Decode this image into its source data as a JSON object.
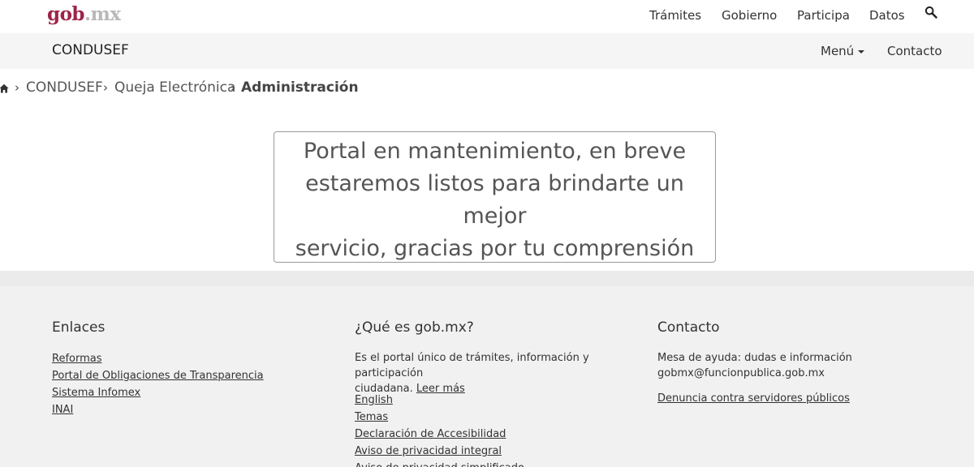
{
  "header": {
    "logo_main": "gob",
    "logo_suffix": ".mx",
    "nav": [
      "Trámites",
      "Gobierno",
      "Participa",
      "Datos"
    ]
  },
  "subheader": {
    "site_name": "CONDUSEF",
    "menu_label": "Menú",
    "contact_label": "Contacto"
  },
  "breadcrumb": {
    "items": [
      "CONDUSEF",
      "Queja Electrónica",
      "Administración"
    ]
  },
  "message": {
    "lines": [
      "Portal en mantenimiento, en breve",
      "estaremos listos para brindarte un mejor",
      "servicio, gracias por tu comprensión"
    ]
  },
  "footer": {
    "enlaces": {
      "title": "Enlaces",
      "links": [
        "Reformas",
        "Portal de Obligaciones de Transparencia",
        "Sistema Infomex",
        "INAI"
      ]
    },
    "que_es": {
      "title": "¿Qué es gob.mx?",
      "text_line1": "Es el portal único de trámites, información y participación",
      "text_line2": "ciudadana.",
      "leer_mas": "Leer más",
      "links": [
        "English",
        "Temas",
        "Declaración de Accesibilidad",
        "Aviso de privacidad integral",
        "Aviso de privacidad simplificado"
      ]
    },
    "contacto": {
      "title": "Contacto",
      "line1": "Mesa de ayuda: dudas e información",
      "line2": "gobmx@funcionpublica.gob.mx",
      "denuncia": "Denuncia contra servidores públicos"
    }
  }
}
